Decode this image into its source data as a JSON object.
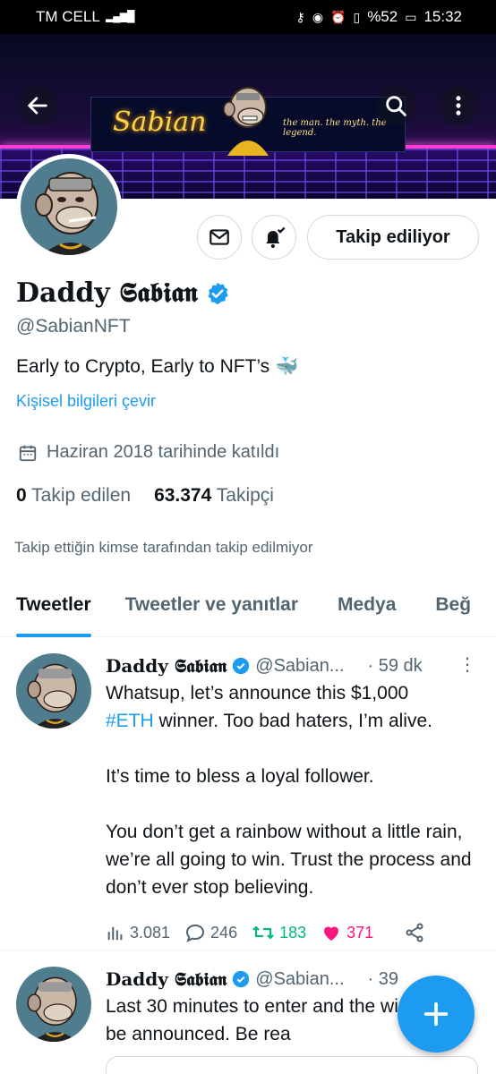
{
  "status_bar": {
    "carrier": "TM CELL",
    "battery": "%52",
    "time": "15:32"
  },
  "banner": {
    "neon_text": "Sabian",
    "tagline": "the man. the myth. the legend."
  },
  "profile": {
    "name": "Daddy 𝕾𝖆𝖇𝖎𝖆𝖓",
    "handle": "@SabianNFT",
    "bio": "Early to Crypto, Early to NFT’s 🐳",
    "translate_link": "Kişisel bilgileri çevir",
    "joined": "Haziran 2018 tarihinde katıldı",
    "following_count": "0",
    "following_label": "Takip edilen",
    "followers_count": "63.374",
    "followers_label": "Takipçi",
    "follow_button": "Takip ediliyor",
    "not_followed_note": "Takip ettiğin kimse tarafından takip edilmiyor"
  },
  "tabs": [
    {
      "label": "Tweetler",
      "active": true
    },
    {
      "label": "Tweetler ve yanıtlar",
      "active": false
    },
    {
      "label": "Medya",
      "active": false
    },
    {
      "label": "Beğ",
      "active": false
    }
  ],
  "tweets": [
    {
      "name": "Daddy 𝕾𝖆𝖇𝖎𝖆𝖓",
      "handle": "@Sabian...",
      "time": "· 59 dk",
      "text_before_tag": "Whatsup, let’s announce this $1,000",
      "hashtag": "#ETH",
      "text_after_tag": " winner. Too bad haters, I’m alive.\n\nIt’s time to bless a loyal follower.\n\nYou don’t get a rainbow without a little rain, we’re all going to win. Trust the process and don’t ever stop believing.",
      "views": "3.081",
      "replies": "246",
      "retweets": "183",
      "likes": "371"
    },
    {
      "name": "Daddy 𝕾𝖆𝖇𝖎𝖆𝖓",
      "handle": "@Sabian...",
      "time": "· 39",
      "text": "Last 30 minutes to enter and the winner will be announced. Be rea"
    }
  ],
  "colors": {
    "accent": "#1d9bf0",
    "retweet": "#00ba7c",
    "like": "#f91880",
    "muted": "#536471"
  }
}
